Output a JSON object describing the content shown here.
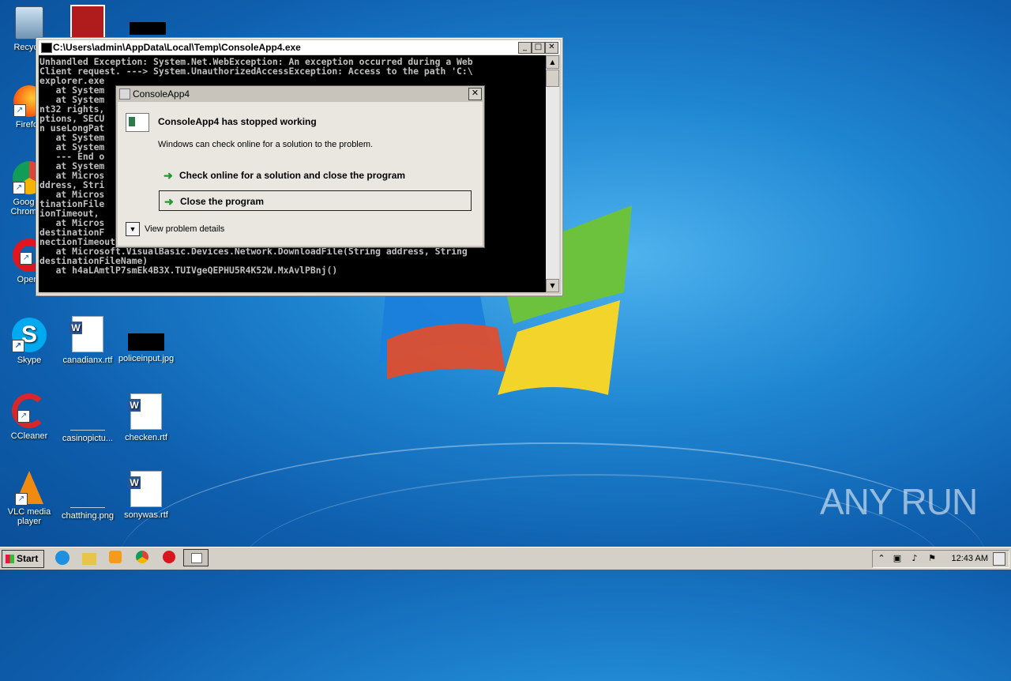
{
  "desktop": {
    "icons": [
      {
        "label": "Recycle",
        "kind": "recycle"
      },
      {
        "label": "Firefo",
        "kind": "firefox"
      },
      {
        "label": "Goog Chrom",
        "kind": "chrome"
      },
      {
        "label": "Oper",
        "kind": "opera"
      },
      {
        "label": "Skype",
        "kind": "skype"
      },
      {
        "label": "canadianx.rtf",
        "kind": "word"
      },
      {
        "label": "policeinput.jpg",
        "kind": "image-black"
      },
      {
        "label": "CCleaner",
        "kind": "ccleaner"
      },
      {
        "label": "casinopictu...",
        "kind": "image-blank"
      },
      {
        "label": "checken.rtf",
        "kind": "word"
      },
      {
        "label": "VLC media player",
        "kind": "vlc"
      },
      {
        "label": "chatthing.png",
        "kind": "image-blank"
      },
      {
        "label": "sonywas.rtf",
        "kind": "word"
      }
    ],
    "watermark": "ANY RUN"
  },
  "console_window": {
    "title": "C:\\Users\\admin\\AppData\\Local\\Temp\\ConsoleApp4.exe",
    "minimize_glyph": "_",
    "maximize_glyph": "□",
    "close_glyph": "✕",
    "text": "Unhandled Exception: System.Net.WebException: An exception occurred during a Web\nClient request. ---> System.UnauthorizedAccessException: Access to the path 'C:\\\nexplorer.exe\n   at System                                                      th)\n   at System                                                      access, I\nnt32 rights,                                                      eOptions o\nptions, SECU                                                      xy, Boolea\nn useLongPat\n   at System                                                      s access)\n   at System\n   --- End o\n   at System\n   at Micros                                                      File(Uri a\nddress, Stri\n   at Micros                                                      String des\ntinationFile                                                      32 connect\nionTimeout,\n   at Micros                                                      s, String\ndestinationF                                                      Int32 con\nnectionTimeout, Boolean overwrite, UICancelOption onUserCancel)\n   at Microsoft.VisualBasic.Devices.Network.DownloadFile(String address, String\ndestinationFileName)\n   at h4aLAmtlP7smEk4B3X.TUIVgeQEPHU5R4K52W.MxAvlPBnj()"
  },
  "error_dialog": {
    "title": "ConsoleApp4",
    "close_glyph": "✕",
    "heading": "ConsoleApp4 has stopped working",
    "message": "Windows can check online for a solution to the problem.",
    "options": [
      {
        "label": "Check online for a solution and close the program",
        "selected": false
      },
      {
        "label": "Close the program",
        "selected": true
      }
    ],
    "details_label": "View problem details",
    "arrow_color": "#1f9a2c"
  },
  "taskbar": {
    "start_label": "Start",
    "pinned": [
      "ie-icon",
      "explorer-icon",
      "media-player-icon",
      "chrome-icon",
      "opera-icon",
      "console-app-icon"
    ],
    "clock": "12:43 AM"
  }
}
